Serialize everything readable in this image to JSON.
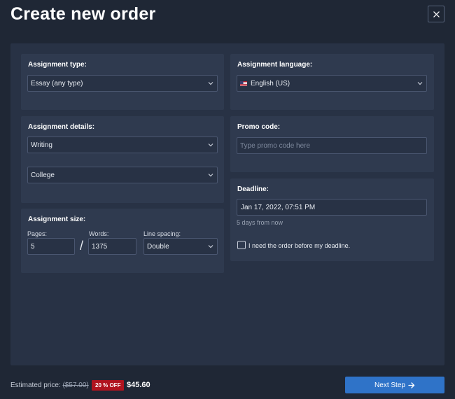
{
  "header": {
    "title": "Create new order",
    "close_icon": "close-icon"
  },
  "assignment_type": {
    "title": "Assignment type:",
    "value": "Essay (any type)"
  },
  "assignment_language": {
    "title": "Assignment language:",
    "value": "English (US)",
    "flag_icon": "us-flag-icon"
  },
  "assignment_details": {
    "title": "Assignment details:",
    "subject": "Writing",
    "level": "College"
  },
  "promo_code": {
    "title": "Promo code:",
    "value": "",
    "placeholder": "Type promo code here"
  },
  "deadline": {
    "title": "Deadline:",
    "value": "Jan 17, 2022, 07:51 PM",
    "hint": "5 days from now",
    "checkbox_label": "I need the order before my deadline.",
    "checked": false
  },
  "assignment_size": {
    "title": "Assignment size:",
    "pages_label": "Pages:",
    "pages": "5",
    "separator": "/",
    "words_label": "Words:",
    "words": "1375",
    "spacing_label": "Line spacing:",
    "spacing": "Double"
  },
  "footer": {
    "estimated_label": "Estimated price:",
    "old_price": "($57.00)",
    "discount": "20 % OFF",
    "new_price": "$45.60",
    "next_label": "Next Step",
    "next_icon": "arrow-right-icon"
  },
  "colors": {
    "accent": "#2f73c8",
    "discount": "#b0141f",
    "background": "#1f2735",
    "card": "#2f3a4f"
  }
}
